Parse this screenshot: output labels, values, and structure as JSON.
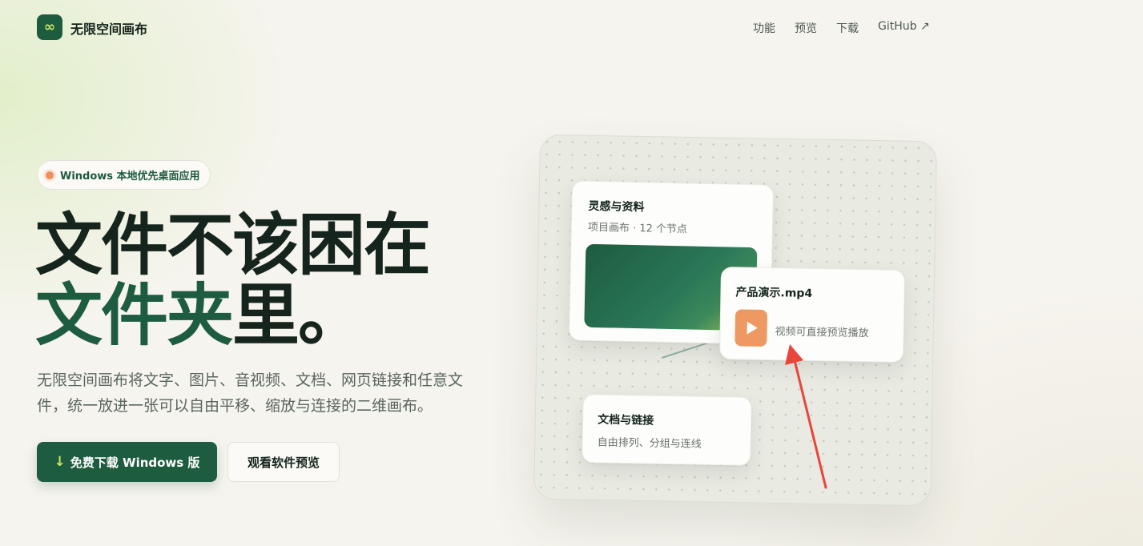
{
  "brand": {
    "logo_glyph": "∞",
    "name": "无限空间画布",
    "color": "#1e5c40"
  },
  "nav": {
    "items": [
      {
        "label": "功能"
      },
      {
        "label": "预览"
      },
      {
        "label": "下载"
      },
      {
        "label": "GitHub ↗"
      }
    ]
  },
  "hero": {
    "badge": "Windows 本地优先桌面应用",
    "headline_line1": "文件不该困在",
    "headline_line2_accent": "文件夹",
    "headline_line2_rest": "里。",
    "subtitle": "无限空间画布将文字、图片、音视频、文档、网页链接和任意文件，统一放进一张可以自由平移、缩放与连接的二维画布。",
    "primary_button_icon": "↓",
    "primary_button_label": "免费下载 Windows 版",
    "secondary_button_label": "观看软件预览"
  },
  "canvas_preview": {
    "nodes": [
      {
        "title": "灵感与资料",
        "meta": "项目画布 · 12 个节点"
      },
      {
        "title": "产品演示.mp4",
        "desc": "视频可直接预览播放"
      },
      {
        "title": "文档与链接",
        "desc": "自由排列、分组与连线"
      }
    ],
    "accent_orange": "#ee9962",
    "annotation_color": "#e8453c"
  }
}
